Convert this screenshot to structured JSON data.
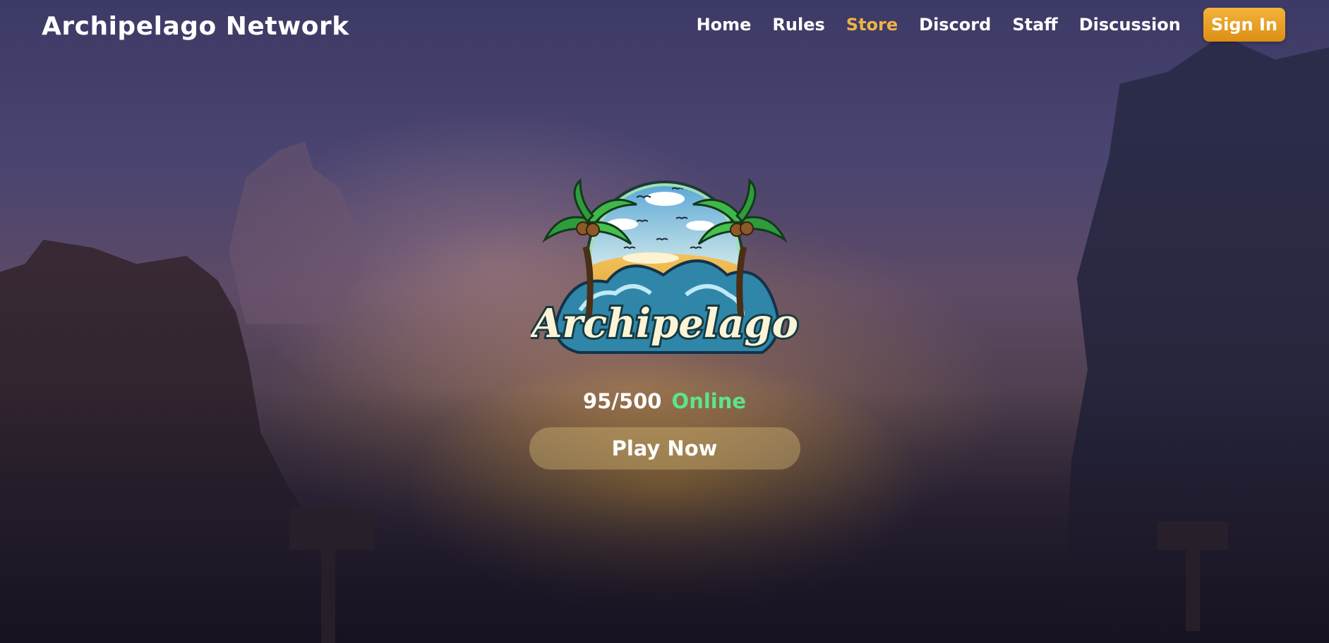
{
  "header": {
    "brand": "Archipelago Network",
    "nav": [
      {
        "label": "Home",
        "active": false
      },
      {
        "label": "Rules",
        "active": false
      },
      {
        "label": "Store",
        "active": true
      },
      {
        "label": "Discord",
        "active": false
      },
      {
        "label": "Staff",
        "active": false
      },
      {
        "label": "Discussion",
        "active": false
      }
    ],
    "signin_label": "Sign In"
  },
  "hero": {
    "logo_text": "Archipelago",
    "players_count": "95/500",
    "players_status": "Online",
    "play_label": "Play Now"
  },
  "colors": {
    "accent": "#efb347",
    "signin_bg": "#f0a52a",
    "online_green": "#5ee38a",
    "text": "#ffffff"
  }
}
